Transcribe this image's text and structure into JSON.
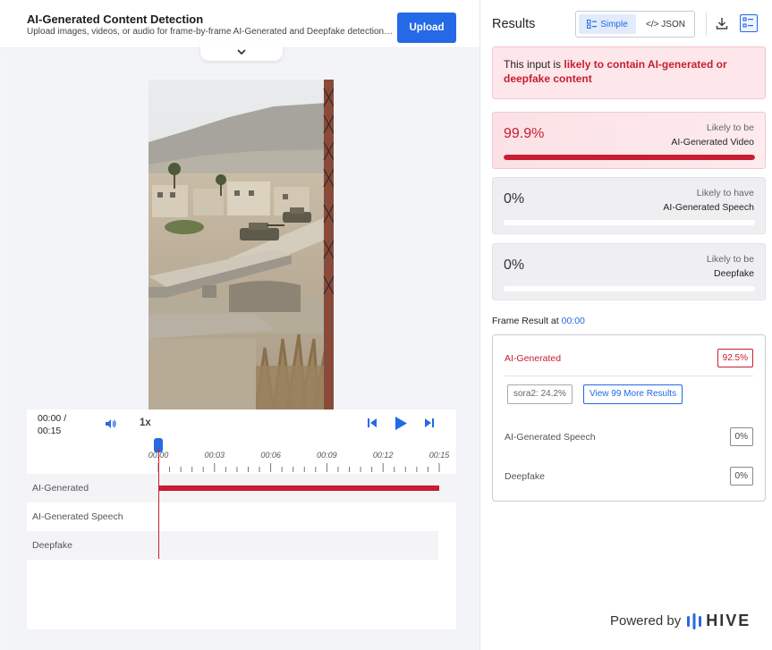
{
  "header": {
    "title": "AI-Generated Content Detection",
    "subtitle": "Upload images, videos, or audio for frame-by-frame AI-Generated and Deepfake detection with...",
    "upload_label": "Upload"
  },
  "player": {
    "time_current": "00:00 /",
    "time_total": "00:15",
    "speed": "1x",
    "ticks": [
      "00:00",
      "00:03",
      "00:06",
      "00:09",
      "00:12",
      "00:15"
    ],
    "playhead_fraction": 0.0,
    "tracks": [
      {
        "label": "AI-Generated",
        "fill_start": 0.0,
        "fill_end": 1.0
      },
      {
        "label": "AI-Generated Speech"
      },
      {
        "label": "Deepfake"
      }
    ]
  },
  "results": {
    "title": "Results",
    "view_simple": "Simple",
    "view_json": "</> JSON",
    "verdict_prefix": "This input is ",
    "verdict_highlight": "likely to contain AI-generated or deepfake content",
    "cards": [
      {
        "value": "99.9%",
        "fraction": 0.999,
        "cap1": "Likely to be",
        "cap2": "AI-Generated Video"
      },
      {
        "value": "0%",
        "fraction": 0.0,
        "cap1": "Likely to have",
        "cap2": "AI-Generated Speech"
      },
      {
        "value": "0%",
        "fraction": 0.0,
        "cap1": "Likely to be",
        "cap2": "Deepfake"
      }
    ],
    "frame_label": "Frame Result at ",
    "frame_time": "00:00",
    "frame": {
      "ai_label": "AI-Generated",
      "ai_value": "92.5%",
      "chip": "sora2: 24.2%",
      "more_label": "View 99 More Results",
      "speech_label": "AI-Generated Speech",
      "speech_value": "0%",
      "deep_label": "Deepfake",
      "deep_value": "0%"
    },
    "powered_by": "Powered by",
    "brand": "HIVE"
  },
  "colors": {
    "accent": "#2469e6",
    "alert": "#c81d32"
  }
}
